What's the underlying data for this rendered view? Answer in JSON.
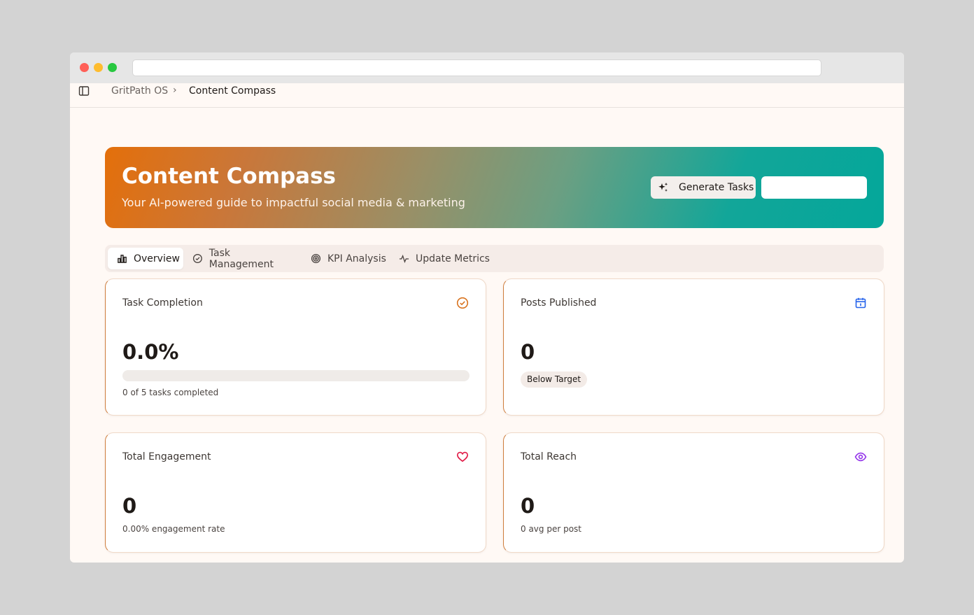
{
  "breadcrumb": {
    "root": "GritPath OS",
    "separator": "›",
    "current": "Content Compass"
  },
  "hero": {
    "title": "Content Compass",
    "subtitle": "Your AI-powered guide to impactful social media & marketing",
    "generate_button_label": "Generate Tasks",
    "secondary_button_label": ""
  },
  "tabs": [
    {
      "label": "Overview",
      "icon": "bar-chart-icon",
      "active": true
    },
    {
      "label": "Task Management",
      "icon": "check-circle-icon",
      "active": false
    },
    {
      "label": "KPI Analysis",
      "icon": "target-icon",
      "active": false
    },
    {
      "label": "Update Metrics",
      "icon": "activity-icon",
      "active": false
    }
  ],
  "cards": {
    "task_completion": {
      "title": "Task Completion",
      "value": "0.0%",
      "progress": 0.0,
      "note": "0 of 5 tasks completed",
      "icon": "check-circle-icon",
      "icon_color": "#d9731f"
    },
    "posts_published": {
      "title": "Posts Published",
      "value": "0",
      "badge": "Below Target",
      "icon": "calendar-icon",
      "icon_color": "#2563eb"
    },
    "total_engagement": {
      "title": "Total Engagement",
      "value": "0",
      "note": "0.00% engagement rate",
      "icon": "heart-icon",
      "icon_color": "#e11d48"
    },
    "total_reach": {
      "title": "Total Reach",
      "value": "0",
      "note": "0 avg per post",
      "icon": "eye-icon",
      "icon_color": "#9333ea"
    }
  },
  "colors": {
    "accent": "#cf7d3c",
    "hero_gradient_start": "#e46f0a",
    "hero_gradient_end": "#04a79a",
    "background": "#fff9f5"
  }
}
